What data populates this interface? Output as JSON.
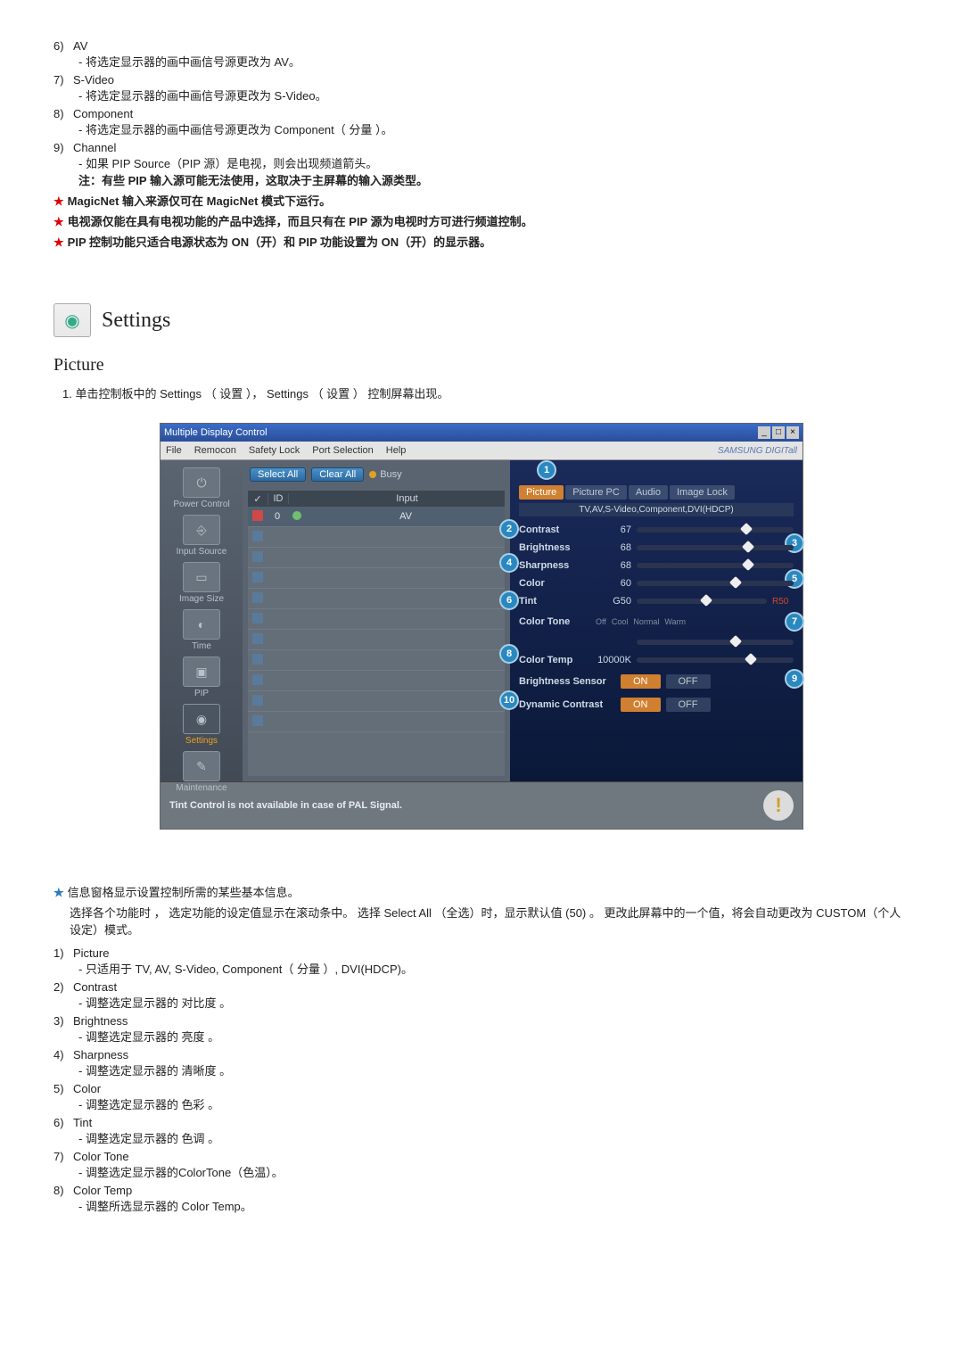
{
  "top_list": [
    {
      "n": "6)",
      "t": "AV",
      "d": "- 将选定显示器的画中画信号源更改为 AV。"
    },
    {
      "n": "7)",
      "t": "S-Video",
      "d": "- 将选定显示器的画中画信号源更改为 S-Video。"
    },
    {
      "n": "8)",
      "t": "Component",
      "d": "- 将选定显示器的画中画信号源更改为 Component（ 分量 ）。"
    },
    {
      "n": "9)",
      "t": "Channel",
      "d": "- 如果 PIP Source（PIP 源）是电视，则会出现频道箭头。"
    }
  ],
  "top_note_bold": "注：有些 PIP 输入源可能无法使用，这取决于主屏幕的输入源类型。",
  "star_lines": [
    "MagicNet 输入来源仅可在 MagicNet 模式下运行。",
    "电视源仅能在具有电视功能的产品中选择，而且只有在 PIP 源为电视时方可进行频道控制。",
    "PIP 控制功能只适合电源状态为 ON（开）和 PIP 功能设置为 ON（开）的显示器。"
  ],
  "section_title": "Settings",
  "subheading": "Picture",
  "instruction": "1. 单击控制板中的 Settings （ 设置 ）， Settings （ 设置 ） 控制屏幕出现。",
  "window": {
    "title": "Multiple Display Control",
    "menus": [
      "File",
      "Remocon",
      "Safety Lock",
      "Port Selection",
      "Help"
    ],
    "brand": "SAMSUNG DIGITall",
    "side": [
      {
        "label": "Power Control"
      },
      {
        "label": "Input Source"
      },
      {
        "label": "Image Size"
      },
      {
        "label": "Time"
      },
      {
        "label": "PIP"
      },
      {
        "label": "Settings",
        "active": true
      },
      {
        "label": "Maintenance"
      }
    ],
    "select_all": "Select All",
    "clear_all": "Clear All",
    "busy": "Busy",
    "grid": {
      "heads": [
        "✓",
        "ID",
        "",
        "Input"
      ],
      "first_id": "0",
      "first_input": "AV"
    },
    "tabs": [
      "Picture",
      "Picture PC",
      "Audio",
      "Image Lock"
    ],
    "src_line": "TV,AV,S-Video,Component,DVI(HDCP)",
    "sliders": [
      {
        "name": "Contrast",
        "val": "67",
        "pct": 67
      },
      {
        "name": "Brightness",
        "val": "68",
        "pct": 68
      },
      {
        "name": "Sharpness",
        "val": "68",
        "pct": 68
      },
      {
        "name": "Color",
        "val": "60",
        "pct": 60
      },
      {
        "name": "Tint",
        "val": "G50",
        "pct": 50,
        "right": "R50"
      }
    ],
    "color_tone": {
      "label": "Color Tone",
      "opts": [
        "Off",
        "Cool",
        "Normal",
        "Warm"
      ]
    },
    "color_temp": {
      "label": "Color Temp",
      "val": "10000K"
    },
    "segs": [
      {
        "label": "Brightness Sensor",
        "on": "ON",
        "off": "OFF"
      },
      {
        "label": "Dynamic Contrast",
        "on": "ON",
        "off": "OFF"
      }
    ],
    "footer_text": "Tint Control is not available in case of PAL Signal."
  },
  "after_info": {
    "line1": "信息窗格显示设置控制所需的某些基本信息。",
    "line2": "选择各个功能时 ， 选定功能的设定值显示在滚动条中。 选择 Select All （全选）时，显示默认值 (50) 。 更改此屏幕中的一个值，将会自动更改为 CUSTOM（个人设定）模式。"
  },
  "bottom_list": [
    {
      "n": "1)",
      "t": "Picture",
      "d": "- 只适用于 TV, AV, S-Video, Component（ 分量 ）, DVI(HDCP)。"
    },
    {
      "n": "2)",
      "t": "Contrast",
      "d": "- 调整选定显示器的 对比度 。"
    },
    {
      "n": "3)",
      "t": "Brightness",
      "d": "- 调整选定显示器的 亮度 。"
    },
    {
      "n": "4)",
      "t": "Sharpness",
      "d": "- 调整选定显示器的 清晰度 。"
    },
    {
      "n": "5)",
      "t": "Color",
      "d": "- 调整选定显示器的 色彩 。"
    },
    {
      "n": "6)",
      "t": "Tint",
      "d": "- 调整选定显示器的 色调 。"
    },
    {
      "n": "7)",
      "t": "Color Tone",
      "d": "- 调整选定显示器的ColorTone（色温）。"
    },
    {
      "n": "8)",
      "t": "Color Temp",
      "d": "- 调整所选显示器的 Color Temp。"
    }
  ]
}
